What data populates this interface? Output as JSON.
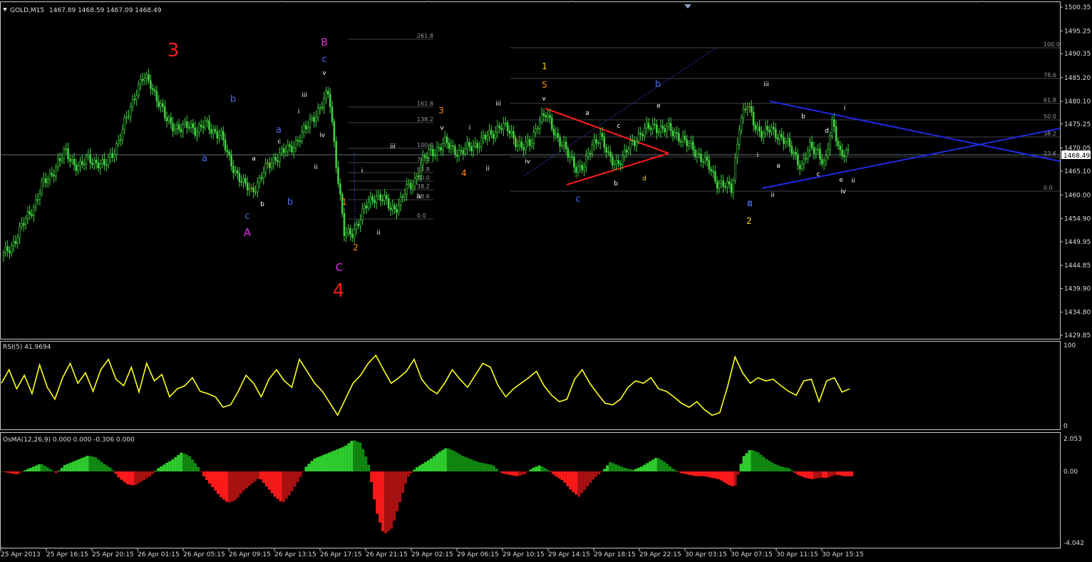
{
  "header": {
    "symbol_label": "GOLD,M15",
    "ohlc": "1467.89 1468.59 1467.09 1468.49"
  },
  "price_scale": {
    "ticks": [
      "1500.35",
      "1495.25",
      "1490.35",
      "1485.20",
      "1480.10",
      "1475.25",
      "1470.05",
      "1465.10",
      "1460.00",
      "1454.90",
      "1449.95",
      "1444.85",
      "1439.90",
      "1434.80",
      "1429.85"
    ],
    "current": "1468.49"
  },
  "rsi": {
    "label": "RSI(5) 41.9694",
    "top": "100",
    "bottom": "0"
  },
  "osma": {
    "label": "OsMA(12,26,9) 0.000 0.000 -0.306 0.000",
    "top": "2.053",
    "mid": "0.00",
    "bottom": "-4.042"
  },
  "time_axis": [
    "25 Apr 2013",
    "25 Apr 16:15",
    "25 Apr 20:15",
    "26 Apr 01:15",
    "26 Apr 05:15",
    "26 Apr 09:15",
    "26 Apr 13:15",
    "26 Apr 17:15",
    "26 Apr 21:15",
    "29 Apr 02:15",
    "29 Apr 06:15",
    "29 Apr 10:15",
    "29 Apr 14:15",
    "29 Apr 18:15",
    "29 Apr 22:15",
    "30 Apr 03:15",
    "30 Apr 07:15",
    "30 Apr 11:15",
    "30 Apr 15:15"
  ],
  "fib1": [
    "261.8",
    "161.8",
    "138.2",
    "100.0",
    "78.6",
    "61.8",
    "50.0",
    "38.2",
    "23.6",
    "0.0"
  ],
  "fib2": [
    "100.0",
    "78.6",
    "61.8",
    "50.0",
    "38.2",
    "23.6",
    "0.0"
  ],
  "waves": [
    {
      "t": "3",
      "c": "#ff1a1a",
      "big": true
    },
    {
      "t": "4",
      "c": "#ff1a1a",
      "big": true
    },
    {
      "t": "A",
      "c": "#e033e0",
      "big": false
    },
    {
      "t": "B",
      "c": "#e033e0",
      "big": false
    },
    {
      "t": "C",
      "c": "#e033e0",
      "big": false
    },
    {
      "t": "a",
      "c": "#4a6cf0"
    },
    {
      "t": "b",
      "c": "#4a6cf0"
    },
    {
      "t": "c",
      "c": "#4a6cf0"
    },
    {
      "t": "a",
      "c": "#4a6cf0"
    },
    {
      "t": "b",
      "c": "#4a6cf0"
    },
    {
      "t": "c",
      "c": "#4a6cf0"
    },
    {
      "t": "c",
      "c": "#4a6cf0"
    },
    {
      "t": "a",
      "c": "#4a6cf0"
    },
    {
      "t": "b",
      "c": "#4a6cf0"
    },
    {
      "t": "c",
      "c": "#4a6cf0"
    },
    {
      "t": "a",
      "c": "#ffffff"
    },
    {
      "t": "b",
      "c": "#ffffff"
    },
    {
      "t": "c",
      "c": "#ffffff"
    },
    {
      "t": "i",
      "c": "#ffffff"
    },
    {
      "t": "ii",
      "c": "#ffffff"
    },
    {
      "t": "iii",
      "c": "#ffffff"
    },
    {
      "t": "iv",
      "c": "#ffffff"
    },
    {
      "t": "v",
      "c": "#ffffff"
    },
    {
      "t": "1",
      "c": "#ff8c1a"
    },
    {
      "t": "2",
      "c": "#ff8c1a"
    },
    {
      "t": "3",
      "c": "#ff8c1a"
    },
    {
      "t": "4",
      "c": "#ff8c1a"
    },
    {
      "t": "i",
      "c": "#ffffff"
    },
    {
      "t": "ii",
      "c": "#ffffff"
    },
    {
      "t": "iii",
      "c": "#ffffff"
    },
    {
      "t": "iv",
      "c": "#ffffff"
    },
    {
      "t": "v",
      "c": "#ffffff"
    },
    {
      "t": "i",
      "c": "#ffffff"
    },
    {
      "t": "ii",
      "c": "#ffffff"
    },
    {
      "t": "iii",
      "c": "#ffffff"
    },
    {
      "t": "iv",
      "c": "#ffffff"
    },
    {
      "t": "v",
      "c": "#ffffff"
    },
    {
      "t": "1",
      "c": "#ffd21a"
    },
    {
      "t": "5",
      "c": "#ff8c1a"
    },
    {
      "t": "2",
      "c": "#ffd21a"
    },
    {
      "t": "a",
      "c": "#ffffff"
    },
    {
      "t": "b",
      "c": "#ffffff"
    },
    {
      "t": "c",
      "c": "#ffffff"
    },
    {
      "t": "d",
      "c": "#ffd21a"
    },
    {
      "t": "e",
      "c": "#ffffff"
    },
    {
      "t": "i",
      "c": "#ffffff"
    },
    {
      "t": "ii",
      "c": "#ffffff"
    },
    {
      "t": "iii",
      "c": "#ffffff"
    },
    {
      "t": "iv",
      "c": "#ffffff"
    },
    {
      "t": "a",
      "c": "#ffffff"
    },
    {
      "t": "b",
      "c": "#ffffff"
    },
    {
      "t": "c",
      "c": "#ffffff"
    },
    {
      "t": "d",
      "c": "#ffffff"
    },
    {
      "t": "e",
      "c": "#ffffff"
    },
    {
      "t": "i",
      "c": "#ffffff"
    },
    {
      "t": "ii",
      "c": "#ffffff"
    }
  ],
  "chart_data": {
    "type": "line",
    "subtype": "candlestick",
    "symbol": "GOLD",
    "timeframe": "M15",
    "ylim": [
      1429.85,
      1500.35
    ],
    "y_ticks": [
      1500.35,
      1495.25,
      1490.35,
      1485.2,
      1480.1,
      1475.25,
      1470.05,
      1465.1,
      1460.0,
      1454.9,
      1449.95,
      1444.85,
      1439.9,
      1434.8,
      1429.85
    ],
    "last_close": 1468.49,
    "x_tick_labels": [
      "25 Apr 2013",
      "25 Apr 16:15",
      "25 Apr 20:15",
      "26 Apr 01:15",
      "26 Apr 05:15",
      "26 Apr 09:15",
      "26 Apr 13:15",
      "26 Apr 17:15",
      "26 Apr 21:15",
      "29 Apr 02:15",
      "29 Apr 06:15",
      "29 Apr 10:15",
      "29 Apr 14:15",
      "29 Apr 18:15",
      "29 Apr 22:15",
      "30 Apr 03:15",
      "30 Apr 07:15",
      "30 Apr 11:15",
      "30 Apr 15:15"
    ],
    "price_path": [
      1447,
      1449,
      1452,
      1455,
      1458,
      1462,
      1464,
      1467,
      1469,
      1467,
      1466,
      1468,
      1467,
      1466,
      1469,
      1472,
      1477,
      1482,
      1485,
      1484,
      1480,
      1476,
      1475,
      1474,
      1475,
      1474,
      1475,
      1474,
      1473,
      1468,
      1465,
      1462,
      1461,
      1463,
      1466,
      1468,
      1469,
      1470,
      1472,
      1474,
      1477,
      1479,
      1482,
      1466,
      1451,
      1452,
      1455,
      1458,
      1460,
      1459,
      1457,
      1458,
      1461,
      1463,
      1467,
      1469,
      1470,
      1471,
      1470,
      1469,
      1470,
      1471,
      1472,
      1473,
      1475,
      1474,
      1472,
      1470,
      1471,
      1476,
      1477,
      1474,
      1471,
      1468,
      1466,
      1466,
      1471,
      1473,
      1468,
      1467,
      1468,
      1471,
      1473,
      1474,
      1475,
      1474,
      1474,
      1473,
      1471,
      1470,
      1468,
      1466,
      1463,
      1462,
      1461,
      1476,
      1479,
      1475,
      1473,
      1474,
      1473,
      1471,
      1469,
      1466,
      1470,
      1470,
      1466,
      1476,
      1469,
      1468.49
    ],
    "rsi": {
      "name": "RSI(5)",
      "last": 41.9694,
      "ylim": [
        0,
        100
      ],
      "values": [
        55,
        72,
        48,
        65,
        42,
        78,
        50,
        35,
        62,
        80,
        55,
        68,
        45,
        72,
        85,
        60,
        52,
        75,
        44,
        80,
        58,
        66,
        38,
        48,
        52,
        62,
        45,
        42,
        38,
        25,
        28,
        45,
        65,
        55,
        38,
        60,
        72,
        58,
        50,
        85,
        70,
        55,
        45,
        30,
        15,
        35,
        55,
        65,
        80,
        90,
        72,
        55,
        62,
        70,
        85,
        60,
        48,
        42,
        55,
        72,
        60,
        50,
        65,
        80,
        75,
        52,
        38,
        48,
        55,
        62,
        70,
        52,
        40,
        32,
        35,
        60,
        72,
        55,
        42,
        30,
        28,
        35,
        50,
        58,
        55,
        62,
        48,
        45,
        38,
        30,
        25,
        32,
        22,
        15,
        18,
        50,
        88,
        68,
        55,
        62,
        58,
        60,
        52,
        45,
        40,
        58,
        60,
        32,
        58,
        62,
        44,
        48
      ]
    },
    "osma": {
      "name": "OsMA(12,26,9)",
      "ylim": [
        -4.042,
        2.053
      ],
      "values": [
        0.0,
        -0.1,
        -0.2,
        0.1,
        0.3,
        0.5,
        0.2,
        -0.1,
        0.4,
        0.6,
        0.8,
        1.0,
        0.9,
        0.5,
        0.2,
        -0.4,
        -0.8,
        -0.9,
        -0.6,
        -0.3,
        0.2,
        0.5,
        0.8,
        1.2,
        1.0,
        0.4,
        -0.4,
        -1.0,
        -1.6,
        -2.0,
        -1.8,
        -1.2,
        -0.8,
        -0.4,
        -1.0,
        -1.6,
        -2.0,
        -1.4,
        -0.6,
        0.3,
        0.8,
        1.0,
        1.2,
        1.4,
        1.6,
        2.0,
        1.8,
        0.5,
        -2.5,
        -4.0,
        -3.6,
        -2.0,
        -0.4,
        0.2,
        0.5,
        0.8,
        1.2,
        1.5,
        1.3,
        1.0,
        0.8,
        0.6,
        0.5,
        0.4,
        -0.1,
        -0.2,
        -0.3,
        -0.2,
        0.2,
        0.4,
        0.1,
        -0.3,
        -0.6,
        -1.2,
        -1.6,
        -1.0,
        -0.4,
        0.0,
        0.6,
        0.4,
        0.2,
        0.1,
        0.3,
        0.6,
        0.9,
        0.6,
        0.2,
        -0.1,
        -0.2,
        -0.3,
        -0.3,
        -0.4,
        -0.5,
        -0.8,
        -1.0,
        0.9,
        1.4,
        1.2,
        0.8,
        0.5,
        0.3,
        0.2,
        -0.2,
        -0.4,
        -0.5,
        -0.4,
        -0.4,
        -0.2,
        -0.3,
        -0.3
      ]
    },
    "fibonacci_levels_1": [
      261.8,
      161.8,
      138.2,
      100.0,
      78.6,
      61.8,
      50.0,
      38.2,
      23.6,
      0.0
    ],
    "fibonacci_levels_2": [
      100.0,
      78.6,
      61.8,
      50.0,
      38.2,
      23.6,
      0.0
    ]
  }
}
